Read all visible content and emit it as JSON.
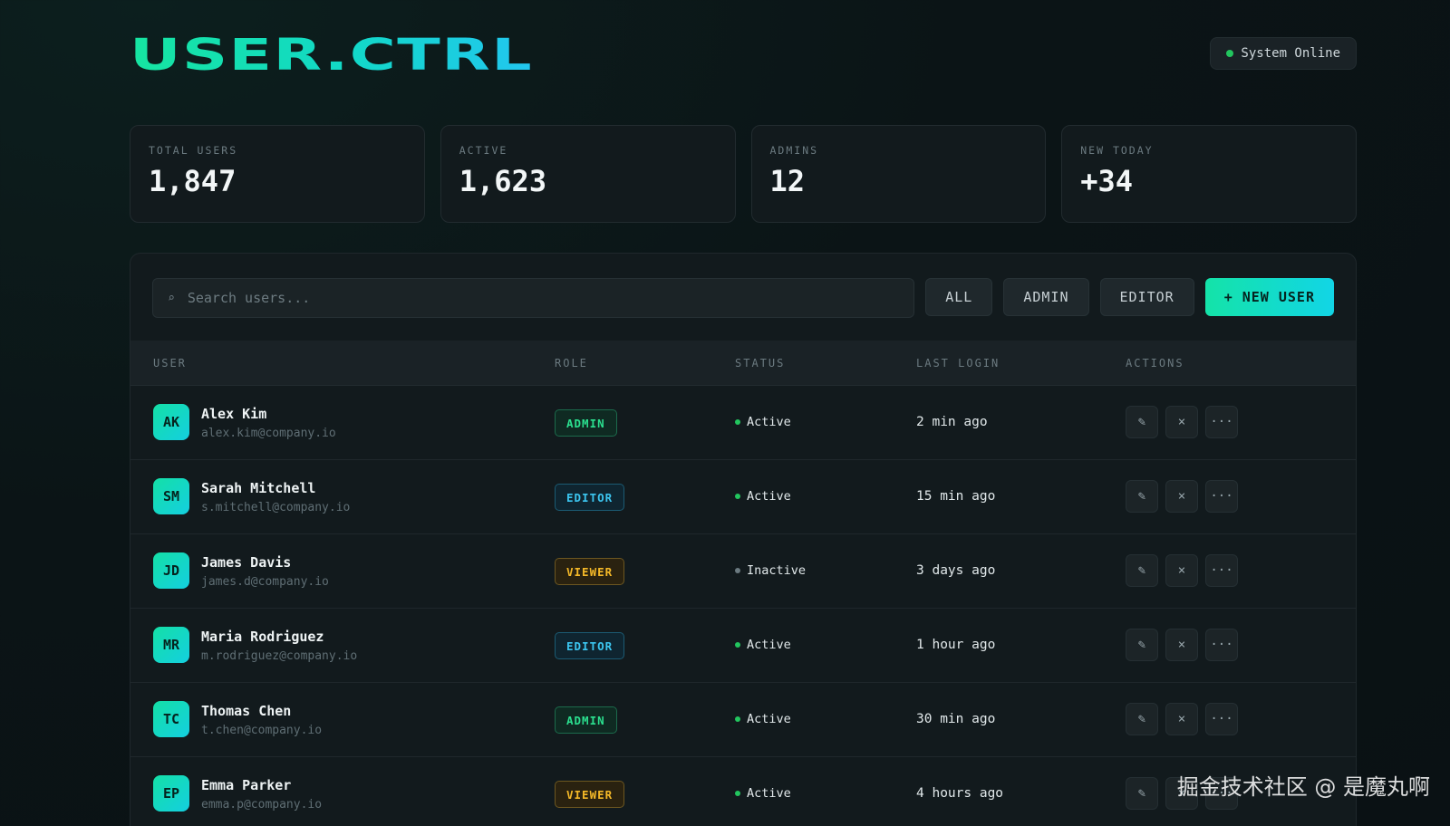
{
  "app": {
    "logo": "USER.CTRL",
    "system_status": "System Online"
  },
  "stats": [
    {
      "label": "TOTAL USERS",
      "value": "1,847"
    },
    {
      "label": "ACTIVE",
      "value": "1,623"
    },
    {
      "label": "ADMINS",
      "value": "12"
    },
    {
      "label": "NEW TODAY",
      "value": "+34"
    }
  ],
  "toolbar": {
    "search_placeholder": "Search users...",
    "filters": [
      "ALL",
      "ADMIN",
      "EDITOR"
    ],
    "new_user": "+ NEW USER"
  },
  "table": {
    "headers": [
      "USER",
      "ROLE",
      "STATUS",
      "LAST LOGIN",
      "ACTIONS"
    ],
    "rows": [
      {
        "initials": "AK",
        "name": "Alex Kim",
        "email": "alex.kim@company.io",
        "role": "ADMIN",
        "status": "Active",
        "last_login": "2 min ago"
      },
      {
        "initials": "SM",
        "name": "Sarah Mitchell",
        "email": "s.mitchell@company.io",
        "role": "EDITOR",
        "status": "Active",
        "last_login": "15 min ago"
      },
      {
        "initials": "JD",
        "name": "James Davis",
        "email": "james.d@company.io",
        "role": "VIEWER",
        "status": "Inactive",
        "last_login": "3 days ago"
      },
      {
        "initials": "MR",
        "name": "Maria Rodriguez",
        "email": "m.rodriguez@company.io",
        "role": "EDITOR",
        "status": "Active",
        "last_login": "1 hour ago"
      },
      {
        "initials": "TC",
        "name": "Thomas Chen",
        "email": "t.chen@company.io",
        "role": "ADMIN",
        "status": "Active",
        "last_login": "30 min ago"
      },
      {
        "initials": "EP",
        "name": "Emma Parker",
        "email": "emma.p@company.io",
        "role": "VIEWER",
        "status": "Active",
        "last_login": "4 hours ago"
      }
    ],
    "action_icons": {
      "edit": "✎",
      "delete": "×",
      "more": "···"
    }
  },
  "colors": {
    "accent": "#14e3a8",
    "active": "#22c55e",
    "inactive": "#6b7a80"
  },
  "watermark": "掘金技术社区 @ 是魔丸啊"
}
